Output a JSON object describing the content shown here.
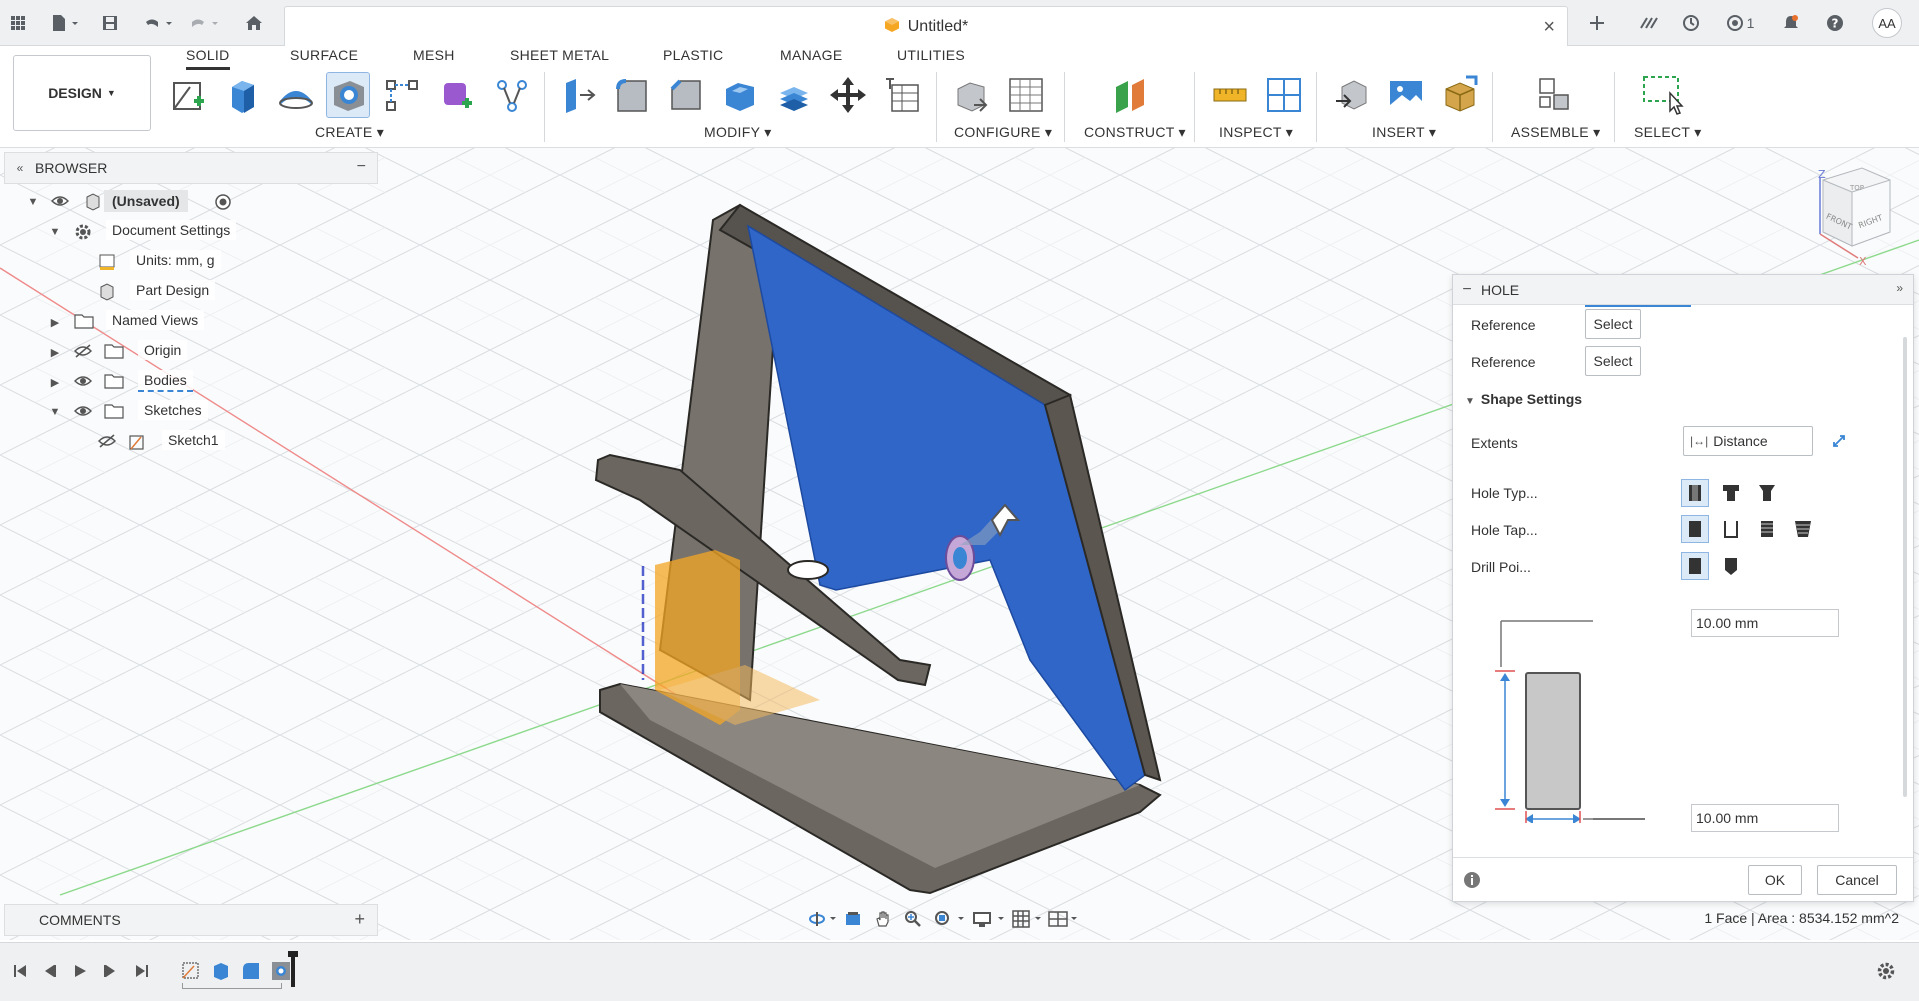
{
  "titlebar": {
    "doc_title": "Untitled*",
    "notif_count": "1",
    "user_initials": "AA"
  },
  "toolbar": {
    "workspace": "DESIGN",
    "tabs": [
      "SOLID",
      "SURFACE",
      "MESH",
      "SHEET METAL",
      "PLASTIC",
      "MANAGE",
      "UTILITIES"
    ],
    "active_tab": "SOLID",
    "groups": {
      "create": "CREATE",
      "modify": "MODIFY",
      "configure": "CONFIGURE",
      "construct": "CONSTRUCT",
      "inspect": "INSPECT",
      "insert": "INSERT",
      "assemble": "ASSEMBLE",
      "select": "SELECT"
    }
  },
  "browser": {
    "title": "BROWSER",
    "items": {
      "root": "(Unsaved)",
      "doc_settings": "Document Settings",
      "units": "Units: mm, g",
      "part_design": "Part Design",
      "named_views": "Named Views",
      "origin": "Origin",
      "bodies": "Bodies",
      "sketches": "Sketches",
      "sketch1": "Sketch1"
    }
  },
  "hole_panel": {
    "title": "HOLE",
    "reference1_label": "Reference",
    "reference1_btn": "Select",
    "reference2_label": "Reference",
    "reference2_btn": "Select",
    "shape_settings": "Shape Settings",
    "extents_label": "Extents",
    "extents_value": "Distance",
    "hole_type_label": "Hole Typ...",
    "hole_tap_label": "Hole Tap...",
    "drill_point_label": "Drill Poi...",
    "depth_value": "10.00 mm",
    "diameter_value": "10.00 mm",
    "ok": "OK",
    "cancel": "Cancel"
  },
  "comments": {
    "title": "COMMENTS"
  },
  "status": {
    "selection": "1 Face | Area : 8534.152 mm^2"
  },
  "viewcube": {
    "front": "FRONT",
    "right": "RIGHT",
    "top": "TOP",
    "axis_z": "Z",
    "axis_x": "X"
  },
  "colors": {
    "accent": "#0696d7",
    "face_selected": "#2f66c8",
    "body": "#6b6660",
    "preview": "#f5a623"
  }
}
